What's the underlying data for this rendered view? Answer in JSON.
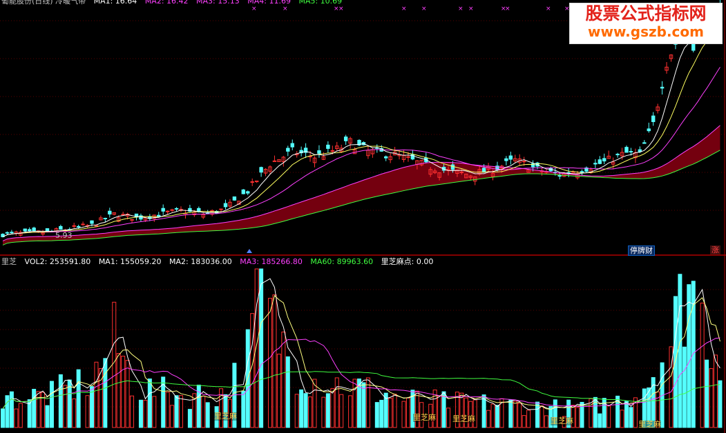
{
  "top_legend": {
    "title": "葡能股份(日线) 冷暖气带",
    "ma1": "MA1: 16.64",
    "ma2": "MA2: 16.42",
    "ma3": "MA3: 15.13",
    "ma4": "MA4: 11.69",
    "ma5": "MA5: 10.69"
  },
  "bottom_legend": {
    "name": "里芝",
    "vol2": "VOL2: 253591.80",
    "ma1": "MA1: 155059.20",
    "ma2": "MA2: 183036.00",
    "ma3": "MA3: 185266.80",
    "ma60": "MA60: 89963.60",
    "point": "里芝麻点: 0.00"
  },
  "watermark": {
    "title": "股票公式指标网",
    "url": "www.gszb.com"
  },
  "tags": {
    "stop": "停牌财",
    "up": "涨"
  },
  "price_low_label": "5.93",
  "marker_label": "里芝麻",
  "colors": {
    "background": "#000000",
    "up_candle": "#ff3030",
    "down_candle": "#54ffff",
    "ma1": "#ffffff",
    "ma2": "#ffff60",
    "ma3": "#ff40ff",
    "ma5": "#40ff40",
    "cloud": "#7a0010",
    "divider": "#b00000"
  },
  "chart_data": [
    {
      "type": "line",
      "title": "葡能股份(日线) 冷暖气带",
      "series": [
        {
          "name": "MA1",
          "last": 16.64
        },
        {
          "name": "MA2",
          "last": 16.42
        },
        {
          "name": "MA3",
          "last": 15.13
        },
        {
          "name": "MA4",
          "last": 11.69
        },
        {
          "name": "MA5",
          "last": 10.69
        }
      ],
      "close_index": [
        {
          "x": 0,
          "y": 5.9
        },
        {
          "x": 10,
          "y": 6.0
        },
        {
          "x": 20,
          "y": 6.4
        },
        {
          "x": 25,
          "y": 7.0
        },
        {
          "x": 30,
          "y": 6.8
        },
        {
          "x": 40,
          "y": 7.2
        },
        {
          "x": 45,
          "y": 7.0
        },
        {
          "x": 50,
          "y": 7.3
        },
        {
          "x": 55,
          "y": 8.3
        },
        {
          "x": 60,
          "y": 9.8
        },
        {
          "x": 65,
          "y": 10.5
        },
        {
          "x": 70,
          "y": 10.2
        },
        {
          "x": 75,
          "y": 10.6
        },
        {
          "x": 78,
          "y": 11.0
        },
        {
          "x": 82,
          "y": 10.5
        },
        {
          "x": 88,
          "y": 10.3
        },
        {
          "x": 95,
          "y": 9.7
        },
        {
          "x": 100,
          "y": 9.4
        },
        {
          "x": 105,
          "y": 9.2
        },
        {
          "x": 110,
          "y": 9.5
        },
        {
          "x": 115,
          "y": 10.0
        },
        {
          "x": 120,
          "y": 9.5
        },
        {
          "x": 125,
          "y": 9.2
        },
        {
          "x": 130,
          "y": 9.5
        },
        {
          "x": 135,
          "y": 9.9
        },
        {
          "x": 140,
          "y": 10.4
        },
        {
          "x": 143,
          "y": 10.3
        },
        {
          "x": 146,
          "y": 12.0
        },
        {
          "x": 149,
          "y": 15.5
        },
        {
          "x": 152,
          "y": 17.0
        },
        {
          "x": 155,
          "y": 16.5
        },
        {
          "x": 158,
          "y": 17.8
        },
        {
          "x": 161,
          "y": 18.0
        }
      ]
    },
    {
      "type": "bar",
      "title": "里芝",
      "series": [
        {
          "name": "VOL2",
          "last": 253591.8
        },
        {
          "name": "MA1",
          "last": 155059.2
        },
        {
          "name": "MA2",
          "last": 183036.0
        },
        {
          "name": "MA3",
          "last": 185266.8
        },
        {
          "name": "MA60",
          "last": 89963.6
        },
        {
          "name": "里芝麻点",
          "last": 0.0
        }
      ],
      "volume_index": [
        {
          "x": 0,
          "y": 0.18
        },
        {
          "x": 10,
          "y": 0.2
        },
        {
          "x": 20,
          "y": 0.3
        },
        {
          "x": 25,
          "y": 0.55
        },
        {
          "x": 30,
          "y": 0.25
        },
        {
          "x": 40,
          "y": 0.2
        },
        {
          "x": 50,
          "y": 0.22
        },
        {
          "x": 55,
          "y": 0.45
        },
        {
          "x": 58,
          "y": 0.9
        },
        {
          "x": 60,
          "y": 0.7
        },
        {
          "x": 65,
          "y": 0.4
        },
        {
          "x": 70,
          "y": 0.3
        },
        {
          "x": 80,
          "y": 0.25
        },
        {
          "x": 90,
          "y": 0.18
        },
        {
          "x": 100,
          "y": 0.16
        },
        {
          "x": 110,
          "y": 0.15
        },
        {
          "x": 120,
          "y": 0.13
        },
        {
          "x": 130,
          "y": 0.12
        },
        {
          "x": 140,
          "y": 0.18
        },
        {
          "x": 145,
          "y": 0.3
        },
        {
          "x": 150,
          "y": 0.55
        },
        {
          "x": 154,
          "y": 0.95
        },
        {
          "x": 157,
          "y": 0.7
        },
        {
          "x": 160,
          "y": 0.5
        }
      ]
    }
  ]
}
